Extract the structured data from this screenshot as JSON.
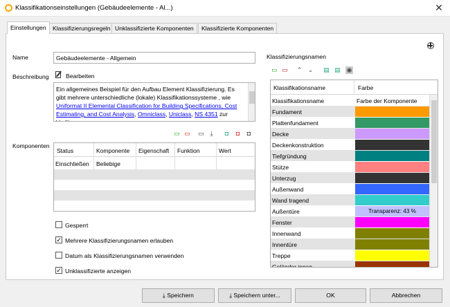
{
  "window": {
    "title": "Klassifikationseinstellungen (Gebäudeelemente - Al...)"
  },
  "tabs": [
    "Einstellungen",
    "Klassifizierungsregeln",
    "Unklassifizierte Komponenten",
    "Klassifizierte Komponenten"
  ],
  "name": {
    "label": "Name",
    "value": "Gebäudeelemente - Allgemein"
  },
  "description": {
    "label": "Beschreibung",
    "edit_label": "Bearbeiten",
    "text1": "Ein allgemeines Beispiel für den Aufbau Element Klassifizierung. Es gibt mehrere unterschiedliche (lokale) Klassifikationssysteme , wie",
    "link1": "Uniformat II Elemental Classification for Building Specifications, Cost Estimating, and Cost Analysis",
    "sep1": ", ",
    "link2": "Omniclass",
    "sep2": ", ",
    "link3": "Uniclass",
    "sep3": ", ",
    "link4": "NS 4351",
    "text2": " zur Verfügung"
  },
  "components": {
    "label": "Komponenten",
    "columns": [
      "Status",
      "Komponente",
      "Eigenschaft",
      "Funktion",
      "Wert"
    ],
    "rows": [
      [
        "Einschließen",
        "Beliebige",
        "",
        "",
        ""
      ]
    ]
  },
  "options": [
    {
      "label": "Gesperrt",
      "checked": false
    },
    {
      "label": "Mehrere Klassifizierungsnamen erlauben",
      "checked": true
    },
    {
      "label": "Datum als Klassifizierungsnamen verwenden",
      "checked": false
    },
    {
      "label": "Unklassifizierte anzeigen",
      "checked": true
    }
  ],
  "classnames": {
    "label": "Klassifizierungsnamen",
    "columns": [
      "Klassifikationsname",
      "Farbe"
    ],
    "header_row": {
      "name": "Klassifikationsname",
      "color_text": "Farbe der Komponente"
    },
    "rows": [
      {
        "name": "Fundament",
        "color": "#ff9900"
      },
      {
        "name": "Plattenfundament",
        "color": "#339966"
      },
      {
        "name": "Decke",
        "color": "#cc99ff"
      },
      {
        "name": "Deckenkonstruktion",
        "color": "#333333"
      },
      {
        "name": "Tiefgründung",
        "color": "#008080"
      },
      {
        "name": "Stütze",
        "color": "#ff8080"
      },
      {
        "name": "Unterzug",
        "color": "#333333"
      },
      {
        "name": "Außenwand",
        "color": "#3366ff"
      },
      {
        "name": "Wand tragend",
        "color": "#33cccc"
      },
      {
        "name": "Außentüre",
        "color": "#c0c0ff",
        "text": "Transparenz: 43 %"
      },
      {
        "name": "Fenster",
        "color": "#ff00ff"
      },
      {
        "name": "Innenwand",
        "color": "#808000"
      },
      {
        "name": "Innentüre",
        "color": "#808000"
      },
      {
        "name": "Treppe",
        "color": "#ffff00"
      },
      {
        "name": "Geländer innen",
        "color": "#993300"
      }
    ]
  },
  "buttons": {
    "save": "Speichern",
    "save_as": "Speichern unter...",
    "ok": "OK",
    "cancel": "Abbrechen"
  },
  "colors": {
    "selection_row": "#e3e3e3",
    "link": "#0000ee"
  }
}
